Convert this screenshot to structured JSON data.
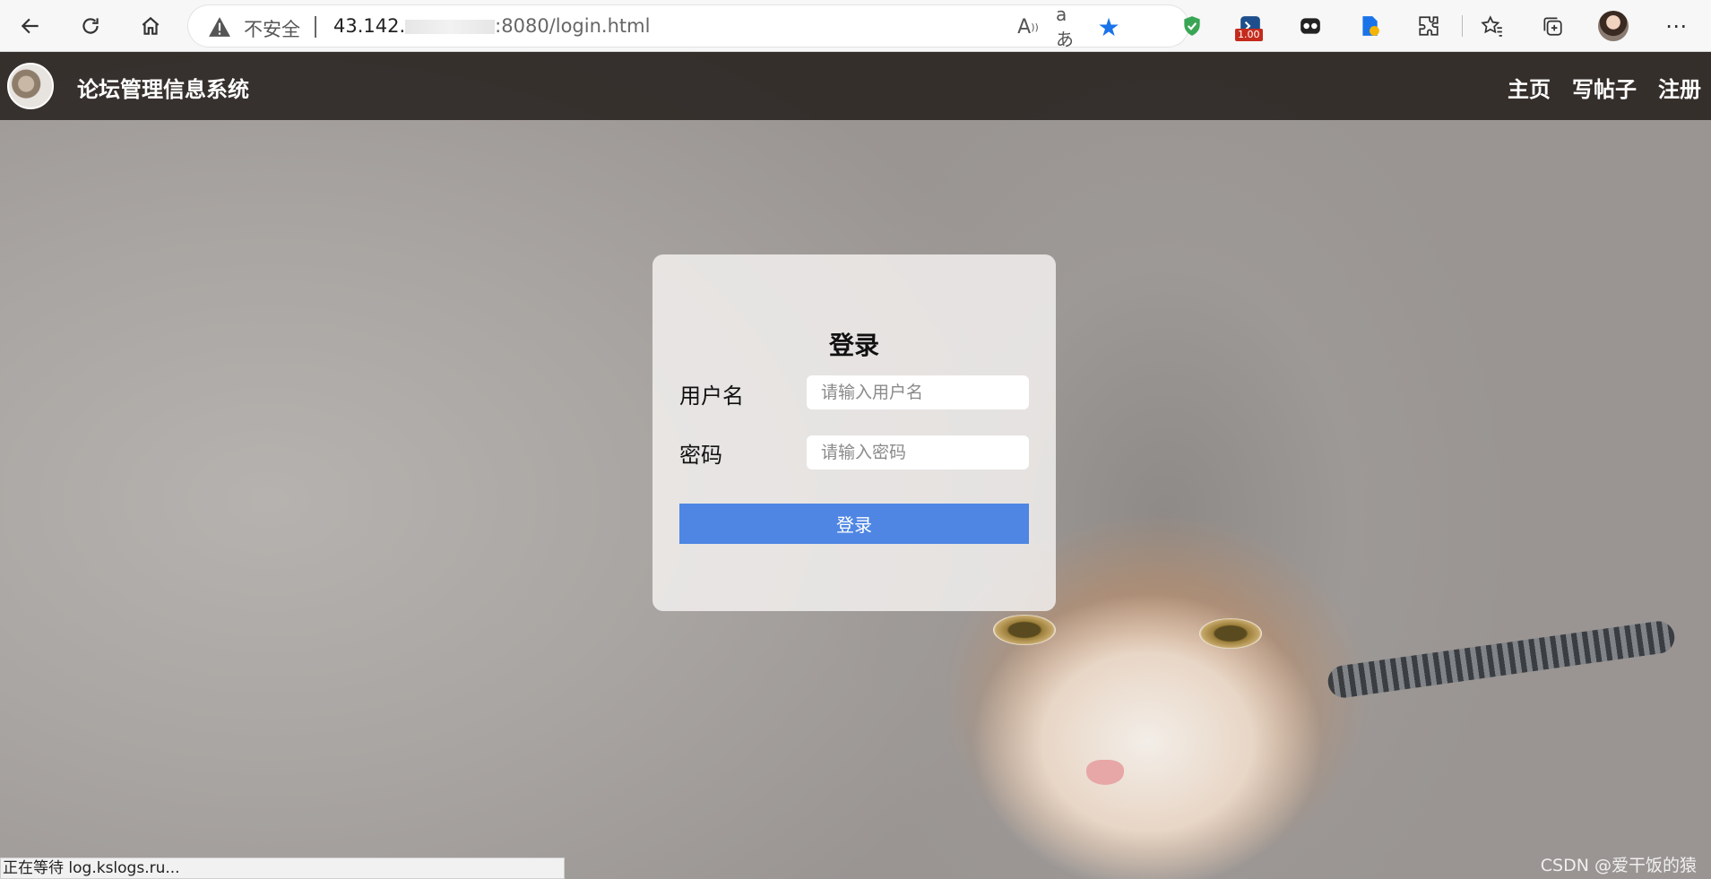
{
  "browser": {
    "security_label": "不安全",
    "url_host": "43.142.",
    "url_rest": ":8080/login.html",
    "extension_badge": "1.00"
  },
  "site": {
    "title": "论坛管理信息系统",
    "nav": [
      "主页",
      "写帖子",
      "注册"
    ]
  },
  "login": {
    "heading": "登录",
    "username_label": "用户名",
    "username_placeholder": "请输入用户名",
    "password_label": "密码",
    "password_placeholder": "请输入密码",
    "submit_label": "登录"
  },
  "status_text": "正在等待 log.kslogs.ru...",
  "watermark": "CSDN @爱干饭的猿",
  "colors": {
    "accent": "#4f86e3",
    "nav_bg": "#1e1916"
  }
}
